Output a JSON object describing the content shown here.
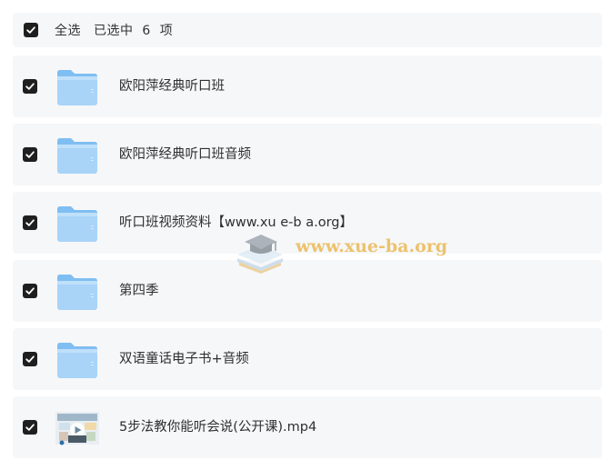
{
  "header": {
    "select_all_label": "全选",
    "selected_text": "已选中  6  项"
  },
  "files": [
    {
      "name": "欧阳萍经典听口班",
      "type": "folder",
      "checked": true
    },
    {
      "name": "欧阳萍经典听口班音频",
      "type": "folder",
      "checked": true
    },
    {
      "name": "听口班视频资料【www.xu e-b a.org】",
      "type": "folder",
      "checked": true
    },
    {
      "name": "第四季",
      "type": "folder",
      "checked": true
    },
    {
      "name": "双语童话电子书+音频",
      "type": "folder",
      "checked": true
    },
    {
      "name": "5步法教你能听会说(公开课).mp4",
      "type": "video",
      "checked": true
    }
  ],
  "watermark": {
    "text": "www.xue-ba.org",
    "icon": "graduation-cap-books-icon",
    "color": "#e8b03c"
  },
  "colors": {
    "row_background": "#f6f7f9",
    "checkbox": "#1f1f1f",
    "folder_light": "#b7dbf9",
    "folder_dark": "#7fbef2"
  }
}
